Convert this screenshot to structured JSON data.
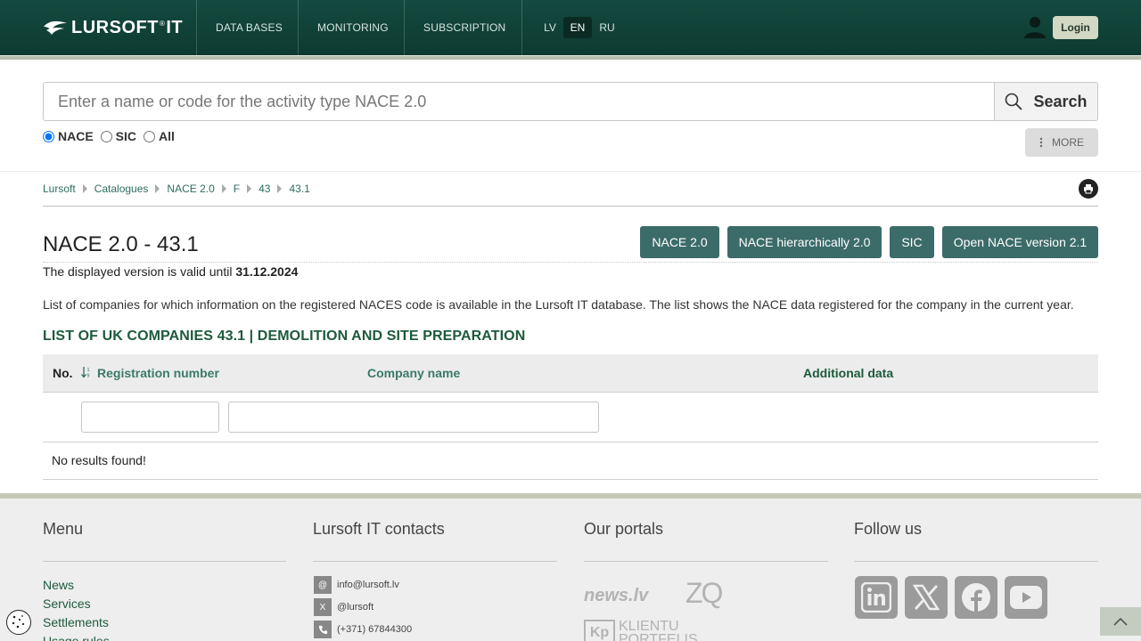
{
  "header": {
    "logo_text": "LURSOFT",
    "logo_suffix": "IT",
    "nav": [
      "DATA BASES",
      "MONITORING",
      "SUBSCRIPTION"
    ],
    "languages": [
      "LV",
      "EN",
      "RU"
    ],
    "active_language": "EN",
    "login_label": "Login"
  },
  "search": {
    "placeholder": "Enter a name or code for the activity type NACE 2.0",
    "button_label": "Search",
    "radios": [
      "NACE",
      "SIC",
      "All"
    ],
    "selected_radio": "NACE",
    "more_label": "MORE"
  },
  "breadcrumb": [
    "Lursoft",
    "Catalogues",
    "NACE 2.0",
    "F",
    "43",
    "43.1"
  ],
  "page": {
    "title": "NACE 2.0 - 43.1",
    "valid_prefix": "The displayed version is valid until",
    "valid_date": "31.12.2024",
    "buttons": [
      "NACE 2.0",
      "NACE hierarchically 2.0",
      "SIC",
      "Open NACE version 2.1"
    ],
    "description": "List of companies for which information on the registered NACES code is available in the Lursoft IT database. The list shows the NACE data registered for the company in the current year.",
    "list_title": "LIST OF UK COMPANIES 43.1 | DEMOLITION AND SITE PREPARATION"
  },
  "table": {
    "columns": [
      "No.",
      "Registration number",
      "Company name",
      "Additional data"
    ],
    "empty_message": "No results found!"
  },
  "footer": {
    "menu_title": "Menu",
    "menu_items": [
      "News",
      "Services",
      "Settlements",
      "Usage rules"
    ],
    "contacts_title": "Lursoft IT contacts",
    "contacts": [
      {
        "icon": "@",
        "text": "info@lursoft.lv"
      },
      {
        "icon": "X",
        "text": "@lursoft"
      },
      {
        "icon": "phone",
        "text": "(+371) 67844300"
      }
    ],
    "portals_title": "Our portals",
    "portals": [
      "news.lv",
      "ZQ",
      "KLIENTU PORTFELIS"
    ],
    "follow_title": "Follow us",
    "socials": [
      "linkedin-icon",
      "x-icon",
      "facebook-icon",
      "youtube-icon"
    ]
  },
  "colors": {
    "header_bg": "#134a3f",
    "accent_button": "#3c6c6a",
    "link": "#2c6e60",
    "list_title": "#1d5a3c"
  }
}
